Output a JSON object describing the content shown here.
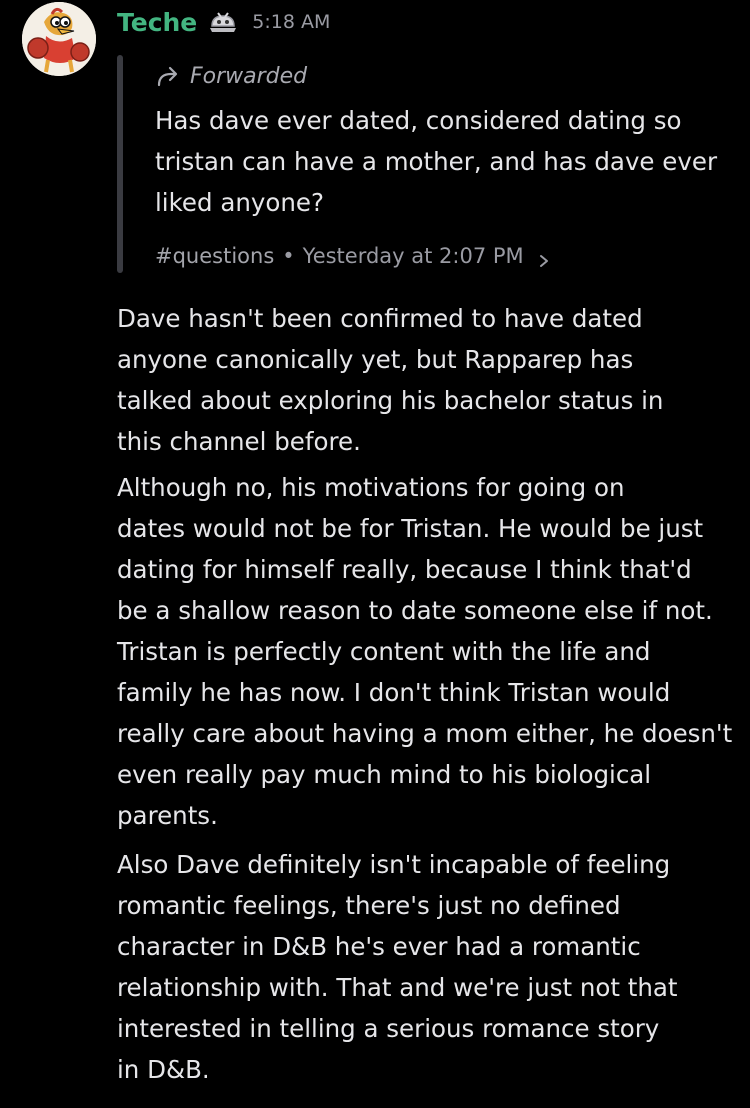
{
  "message": {
    "username": "Teche",
    "timestamp": "5:18 AM",
    "avatar": "cartoon-character-avatar",
    "role_icon": "role-badge-icon",
    "colors": {
      "username": "#43b581",
      "background": "#000000",
      "text": "#e6e6e9",
      "muted": "#9a9ba3"
    }
  },
  "forward": {
    "label": "Forwarded",
    "icon": "forward-arrow-icon",
    "text": "Has dave ever dated, considered dating so\ntristan can have a mother, and has dave ever\nliked anyone?",
    "channel": "#questions",
    "separator": "•",
    "time": "Yesterday at 2:07 PM",
    "chevron": "chevron-right-icon"
  },
  "body": {
    "p1": "      Dave hasn't been confirmed to have dated\n      anyone canonically yet, but Rapparep has\n      talked about exploring his bachelor status in\n      this channel before.",
    "p2": "      Although no, his motivations for going on\ndates would not be for Tristan. He would be just\ndating for himself really, because I think that'd\nbe a shallow reason to date someone else if not.",
    "p3": "      Tristan is perfectly content with the life and\nfamily he has now. I don't think Tristan would\nreally care about having a mom either, he doesn't\neven really pay much mind to his biological\nparents.",
    "p4": "      Also Dave definitely isn't incapable of feeling\n      romantic feelings, there's just no defined\n      character in D&B he's ever had a romantic\n      relationship with. That and we're just not that\n      interested in telling a serious romance story\n      in D&B."
  }
}
